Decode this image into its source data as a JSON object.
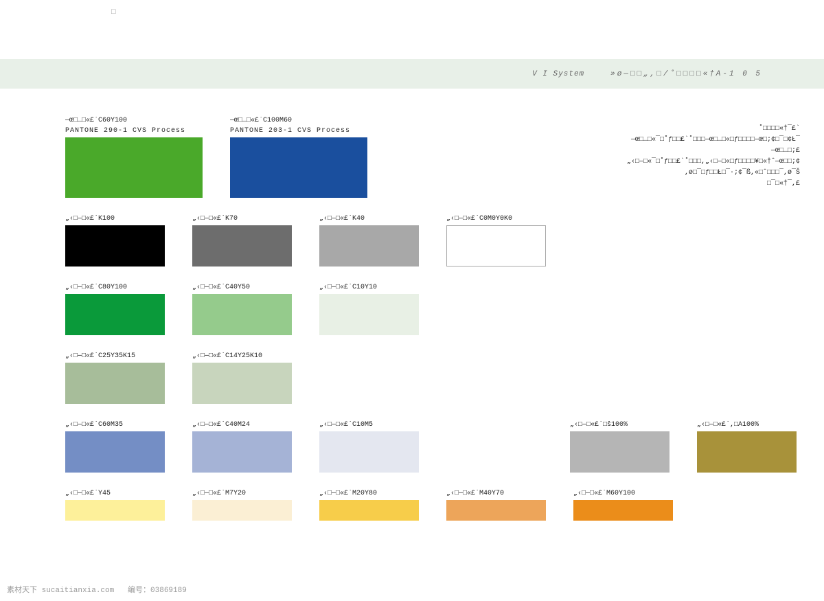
{
  "top_placeholder": "□",
  "header": {
    "system_label": "V I  System",
    "page_code": "»ø—□□„,□/˚□□□□«†A-1 0 5"
  },
  "side_paragraph": {
    "line1": "˚□□□□«†¯£`",
    "line2": "—œ□…□«¯□˚ƒ□□£`˚□□□—œ□…□«□ƒ□□□□—œ□;¢□¯□¢Ł¯",
    "line3": "—œ□…□;£",
    "line4": "„‹□—□«¯□˚ƒ□□£`˚□□□,„‹□—□«□ƒ□□□□¥□«†ˆ—œ□□;¢",
    "line5": ",ø□¯□ƒ□□Ł□¯·;¢¯ß,«□ˆ□□□¯,ø¯Š",
    "line6": "□¯□«†¯,£"
  },
  "rows": [
    {
      "type": "primary",
      "items": [
        {
          "label1": "—œ□…□«£`C60Y100",
          "label2": "PANTONE 290-1 CVS Process",
          "color": "#4aa92a"
        },
        {
          "label1": "—œ□…□«£`C100M60",
          "label2": "PANTONE 203-1 CVS Process",
          "color": "#1a4f9e"
        }
      ]
    },
    {
      "type": "quad",
      "items": [
        {
          "label": "„‹□—□«£`K100",
          "color": "#000000"
        },
        {
          "label": "„‹□—□«£`K70",
          "color": "#6d6d6d"
        },
        {
          "label": "„‹□—□«£`K40",
          "color": "#a8a8a8"
        },
        {
          "label": "„‹□—□«£`C0M0Y0K0",
          "color": "#ffffff",
          "bordered": true
        }
      ]
    },
    {
      "type": "triple",
      "items": [
        {
          "label": "„‹□—□«£`C80Y100",
          "color": "#0a9a3a"
        },
        {
          "label": "„‹□—□«£`C40Y50",
          "color": "#95cb8c"
        },
        {
          "label": "„‹□—□«£`C10Y10",
          "color": "#e8f0e5"
        }
      ]
    },
    {
      "type": "double",
      "items": [
        {
          "label": "„‹□—□«£`C25Y35K15",
          "color": "#a7bd9a"
        },
        {
          "label": "„‹□—□«£`C14Y25K10",
          "color": "#c8d5bd"
        }
      ]
    },
    {
      "type": "triple_plus_right",
      "items": [
        {
          "label": "„‹□—□«£`C60M35",
          "color": "#748ec5"
        },
        {
          "label": "„‹□—□«£`C40M24",
          "color": "#a5b3d6"
        },
        {
          "label": "„‹□—□«£`C10M5",
          "color": "#e4e7f0"
        }
      ],
      "right_items": [
        {
          "label": "„‹□—□«£`□š100%",
          "color": "#b5b5b5"
        },
        {
          "label": "„‹□—□«£`,□Â100%",
          "color": "#a8923a"
        }
      ]
    },
    {
      "type": "penta_small",
      "items": [
        {
          "label": "„‹□—□«£`Y45",
          "color": "#fdf09a"
        },
        {
          "label": "„‹□—□«£`M7Y20",
          "color": "#fbefd4"
        },
        {
          "label": "„‹□—□«£`M20Y80",
          "color": "#f7cd4a"
        },
        {
          "label": "„‹□—□«£`M40Y70",
          "color": "#eda55a"
        },
        {
          "label": "„‹□—□«£`M60Y100",
          "color": "#eb8d1a"
        }
      ]
    }
  ],
  "footer": {
    "site": "素材天下 sucaitianxia.com",
    "id_label": "编号：",
    "id_value": "03869189"
  }
}
